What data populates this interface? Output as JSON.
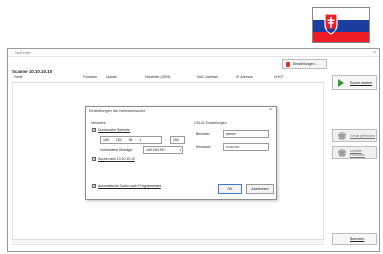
{
  "window": {
    "title": "NetFinder",
    "close": "×",
    "scan_label": "Scanne 10.10.10.10",
    "settings_button": "Einstellungen ..."
  },
  "table": {
    "columns": [
      "Gerät",
      "Firmware",
      "Update",
      "Hersteller (OEM)",
      "MAC-Adresse",
      "IP-Adresse",
      "DHCP"
    ]
  },
  "side": {
    "start_search": "Suche starten",
    "open_device": "Gerät gefunden",
    "update_firmware": "Update Firmware",
    "exit": "Beenden"
  },
  "dialog": {
    "title": "Einstellungen der Netzwerksuche",
    "close": "×",
    "network_section": "Netzwerk",
    "subnet_check_label": "Durchsuche Subnetz:",
    "subnet_check": "✓",
    "ip_octets": [
      "169",
      "254",
      "55",
      "1"
    ],
    "ip_sep_dot": ".",
    "ip_dash": "-",
    "ip_range_end": "254",
    "existing_label": "Vorhandene Einträge:",
    "existing_value": "169.254.55.*",
    "search_after_check": "✓",
    "search_after_label": "Suche nach 10.10.10.10",
    "cs_section": "CS141 Einstellungen",
    "user_label": "Benutzer:",
    "user_value": "admin",
    "password_label": "Kennwort:",
    "password_value": "•••••••••••",
    "auto_check": "✓",
    "auto_label": "Automatische Suche nach Programmstart",
    "ok": "OK",
    "cancel": "Abbrechen"
  },
  "colors": {
    "flag_white": "#ffffff",
    "flag_blue": "#1b3fa0",
    "flag_red": "#ee1c25",
    "play_green": "#2d9a2d",
    "ok_border": "#3a78d8"
  }
}
